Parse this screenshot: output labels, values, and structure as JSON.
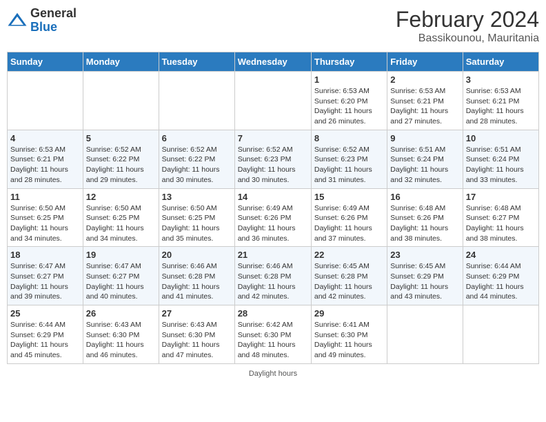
{
  "header": {
    "logo_general": "General",
    "logo_blue": "Blue",
    "month_year": "February 2024",
    "location": "Bassikounou, Mauritania"
  },
  "days_of_week": [
    "Sunday",
    "Monday",
    "Tuesday",
    "Wednesday",
    "Thursday",
    "Friday",
    "Saturday"
  ],
  "weeks": [
    [
      {
        "day": "",
        "info": ""
      },
      {
        "day": "",
        "info": ""
      },
      {
        "day": "",
        "info": ""
      },
      {
        "day": "",
        "info": ""
      },
      {
        "day": "1",
        "info": "Sunrise: 6:53 AM\nSunset: 6:20 PM\nDaylight: 11 hours and 26 minutes."
      },
      {
        "day": "2",
        "info": "Sunrise: 6:53 AM\nSunset: 6:21 PM\nDaylight: 11 hours and 27 minutes."
      },
      {
        "day": "3",
        "info": "Sunrise: 6:53 AM\nSunset: 6:21 PM\nDaylight: 11 hours and 28 minutes."
      }
    ],
    [
      {
        "day": "4",
        "info": "Sunrise: 6:53 AM\nSunset: 6:21 PM\nDaylight: 11 hours and 28 minutes."
      },
      {
        "day": "5",
        "info": "Sunrise: 6:52 AM\nSunset: 6:22 PM\nDaylight: 11 hours and 29 minutes."
      },
      {
        "day": "6",
        "info": "Sunrise: 6:52 AM\nSunset: 6:22 PM\nDaylight: 11 hours and 30 minutes."
      },
      {
        "day": "7",
        "info": "Sunrise: 6:52 AM\nSunset: 6:23 PM\nDaylight: 11 hours and 30 minutes."
      },
      {
        "day": "8",
        "info": "Sunrise: 6:52 AM\nSunset: 6:23 PM\nDaylight: 11 hours and 31 minutes."
      },
      {
        "day": "9",
        "info": "Sunrise: 6:51 AM\nSunset: 6:24 PM\nDaylight: 11 hours and 32 minutes."
      },
      {
        "day": "10",
        "info": "Sunrise: 6:51 AM\nSunset: 6:24 PM\nDaylight: 11 hours and 33 minutes."
      }
    ],
    [
      {
        "day": "11",
        "info": "Sunrise: 6:50 AM\nSunset: 6:25 PM\nDaylight: 11 hours and 34 minutes."
      },
      {
        "day": "12",
        "info": "Sunrise: 6:50 AM\nSunset: 6:25 PM\nDaylight: 11 hours and 34 minutes."
      },
      {
        "day": "13",
        "info": "Sunrise: 6:50 AM\nSunset: 6:25 PM\nDaylight: 11 hours and 35 minutes."
      },
      {
        "day": "14",
        "info": "Sunrise: 6:49 AM\nSunset: 6:26 PM\nDaylight: 11 hours and 36 minutes."
      },
      {
        "day": "15",
        "info": "Sunrise: 6:49 AM\nSunset: 6:26 PM\nDaylight: 11 hours and 37 minutes."
      },
      {
        "day": "16",
        "info": "Sunrise: 6:48 AM\nSunset: 6:26 PM\nDaylight: 11 hours and 38 minutes."
      },
      {
        "day": "17",
        "info": "Sunrise: 6:48 AM\nSunset: 6:27 PM\nDaylight: 11 hours and 38 minutes."
      }
    ],
    [
      {
        "day": "18",
        "info": "Sunrise: 6:47 AM\nSunset: 6:27 PM\nDaylight: 11 hours and 39 minutes."
      },
      {
        "day": "19",
        "info": "Sunrise: 6:47 AM\nSunset: 6:27 PM\nDaylight: 11 hours and 40 minutes."
      },
      {
        "day": "20",
        "info": "Sunrise: 6:46 AM\nSunset: 6:28 PM\nDaylight: 11 hours and 41 minutes."
      },
      {
        "day": "21",
        "info": "Sunrise: 6:46 AM\nSunset: 6:28 PM\nDaylight: 11 hours and 42 minutes."
      },
      {
        "day": "22",
        "info": "Sunrise: 6:45 AM\nSunset: 6:28 PM\nDaylight: 11 hours and 42 minutes."
      },
      {
        "day": "23",
        "info": "Sunrise: 6:45 AM\nSunset: 6:29 PM\nDaylight: 11 hours and 43 minutes."
      },
      {
        "day": "24",
        "info": "Sunrise: 6:44 AM\nSunset: 6:29 PM\nDaylight: 11 hours and 44 minutes."
      }
    ],
    [
      {
        "day": "25",
        "info": "Sunrise: 6:44 AM\nSunset: 6:29 PM\nDaylight: 11 hours and 45 minutes."
      },
      {
        "day": "26",
        "info": "Sunrise: 6:43 AM\nSunset: 6:30 PM\nDaylight: 11 hours and 46 minutes."
      },
      {
        "day": "27",
        "info": "Sunrise: 6:43 AM\nSunset: 6:30 PM\nDaylight: 11 hours and 47 minutes."
      },
      {
        "day": "28",
        "info": "Sunrise: 6:42 AM\nSunset: 6:30 PM\nDaylight: 11 hours and 48 minutes."
      },
      {
        "day": "29",
        "info": "Sunrise: 6:41 AM\nSunset: 6:30 PM\nDaylight: 11 hours and 49 minutes."
      },
      {
        "day": "",
        "info": ""
      },
      {
        "day": "",
        "info": ""
      }
    ]
  ],
  "footer": {
    "daylight_hours_label": "Daylight hours"
  }
}
